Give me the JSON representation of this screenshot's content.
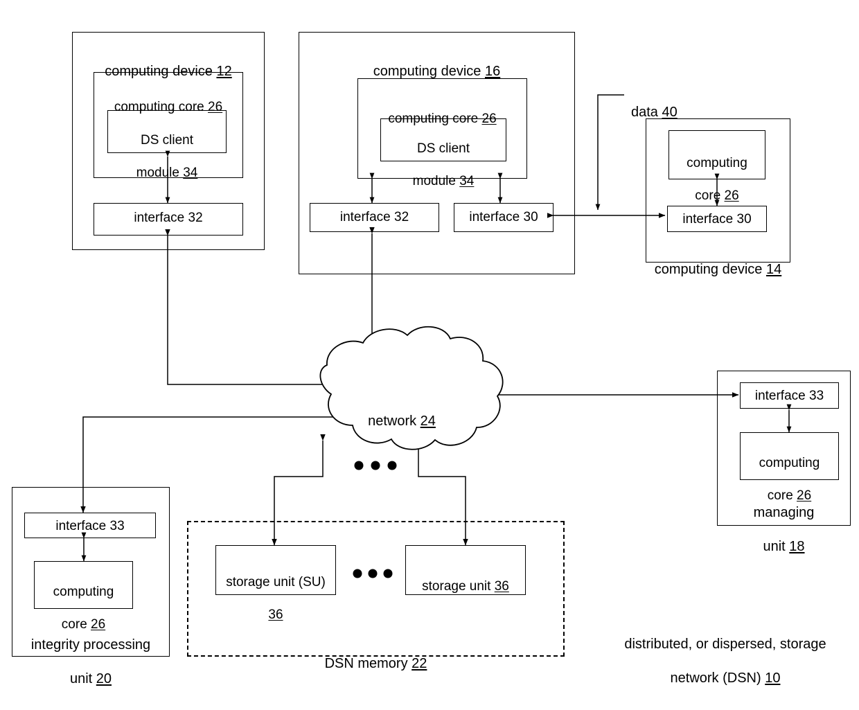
{
  "figure": {
    "title": "distributed, or dispersed, storage network (DSN) 10",
    "caption_line1": "distributed, or dispersed, storage",
    "caption_line2": "network (DSN) ",
    "caption_ref": "10"
  },
  "device12": {
    "title_text": "computing device ",
    "title_ref": "12",
    "core_text": "computing core ",
    "core_ref": "26",
    "ds_client_line1": "DS client",
    "ds_client_line2": "module ",
    "ds_client_ref": "34",
    "interface_label": "interface 32"
  },
  "device16": {
    "title_text": "computing device ",
    "title_ref": "16",
    "core_text": "computing core ",
    "core_ref": "26",
    "ds_client_line1": "DS client",
    "ds_client_line2": "module ",
    "ds_client_ref": "34",
    "interface32_label": "interface 32",
    "interface30_label": "interface 30"
  },
  "device14": {
    "title_text": "computing device ",
    "title_ref": "14",
    "core_line1": "computing",
    "core_line2": "core ",
    "core_ref": "26",
    "interface30_label": "interface 30"
  },
  "data_flow": {
    "label_text": "data ",
    "label_ref": "40"
  },
  "network": {
    "label_text": "network ",
    "label_ref": "24"
  },
  "managing_unit": {
    "interface_label": "interface 33",
    "core_line1": "computing",
    "core_line2": "core ",
    "core_ref": "26",
    "title_line1": "managing",
    "title_line2": "unit ",
    "title_ref": "18"
  },
  "integrity_unit": {
    "interface_label": "interface 33",
    "core_line1": "computing",
    "core_line2": "core ",
    "core_ref": "26",
    "title_line1": "integrity  processing",
    "title_line2": "unit ",
    "title_ref": "20"
  },
  "dsn_memory": {
    "title_text": "DSN memory ",
    "title_ref": "22",
    "storage_units": [
      {
        "line1": "storage unit (SU)",
        "line2": "",
        "ref": "36"
      },
      {
        "line1": "storage unit ",
        "line2": "",
        "ref": "36"
      }
    ],
    "ellipsis": "●●●"
  },
  "cloud_ellipsis": "●●●",
  "colors": {
    "stroke": "#000000",
    "background": "#ffffff"
  }
}
